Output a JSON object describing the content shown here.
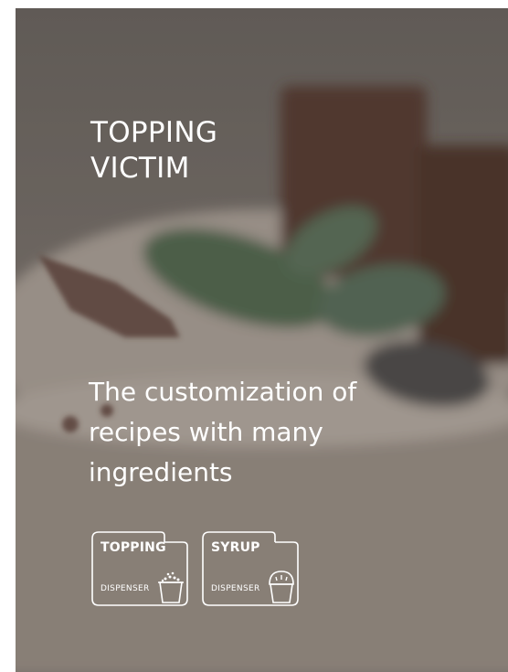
{
  "hero": {
    "title_lines": [
      "TOPPING",
      "VICTIM"
    ],
    "description_lines": [
      "The customization of",
      "recipes with many",
      "ingredients"
    ]
  },
  "badges": [
    {
      "title": "TOPPING",
      "subtitle": "DISPENSER",
      "icon": "topping-cup-icon"
    },
    {
      "title": "SYRUP",
      "subtitle": "DISPENSER",
      "icon": "syrup-cup-icon"
    }
  ],
  "colors": {
    "text": "#ffffff",
    "background_tint": "#5d544e",
    "chocolate": "#4a2d24",
    "mint_leaf": "#4e6a4c",
    "cream": "#cfc6bd"
  }
}
